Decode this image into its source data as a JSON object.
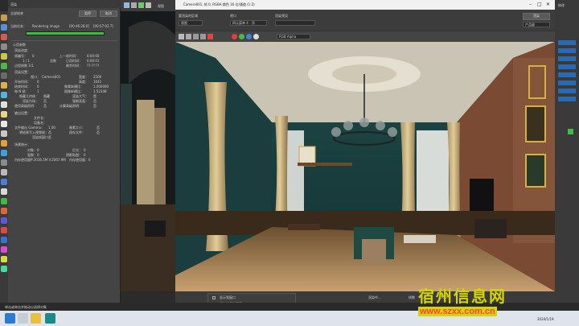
{
  "progress_window": {
    "title": "渲染",
    "pause_label": "暂停",
    "cancel_label": "取消",
    "header_label": "全部结束",
    "current_task_label": "当前任务：",
    "current_task_value": "Rendering image",
    "time1": "[00:46:28.0]",
    "time2": "[00:57:02.7]",
    "progress_percent": 100,
    "common_params_title": "公用参数",
    "render_progress_label": "渲染进度：",
    "frame_count_label": "帧编号：",
    "frame_count_value": "0",
    "last_frame_time_label": "上一帧时间：",
    "last_frame_time_value": "0:00:00",
    "frames_done_value": "1 / 1",
    "total_label": "总数",
    "elapsed_label": "已用时间：",
    "elapsed_value": "0:00:01",
    "pass_label": "过程帧数 1/1",
    "remaining_label": "剩余时间：",
    "remaining_value": "??:??:??",
    "render_settings_title": "渲染设置：",
    "viewport_label": "视口：",
    "viewport_value": "Camera001",
    "width_label": "宽度：",
    "width_value": "2500",
    "cameras_label": "开始时间：",
    "cameras_value": "0",
    "height_label": "高度：",
    "height_value": "1641",
    "end_label": "结束时间：",
    "end_value": "0",
    "aspect_label": "像素纵横比：",
    "aspect_value": "1.000000",
    "frames_label": "每 N 帧：",
    "frames_value": "1",
    "img_aspect_label": "图像纵横比：",
    "img_aspect_value": "1.52348",
    "fx1_label": "隐藏几何体：",
    "fx1_value": "隐藏",
    "fx2_label": "渲染大气：",
    "fx2_value": "是",
    "fx3_label": "渲染为场：",
    "fx3_value": "否",
    "fx4_label": "强制双面：",
    "fx4_value": "否",
    "fx5_label": "使用高级照明：",
    "fx5_value": "否",
    "fx6_label": "计算高级照明：",
    "fx6_value": "否",
    "output_title": "输出设置：",
    "out1": "文件名：",
    "out2": "设备名：",
    "out3_label": "文件输出 Gamma：",
    "out3_value": "1.00",
    "out4_label": "像素大小：",
    "out4_value": "否",
    "out5_label": "将结果写入视频帧：",
    "out5_value": "否",
    "out6_label": "保存文件：",
    "out6_value": "否",
    "out7_label": "渲染帧窗口：",
    "out7_value": "否",
    "stats_title": "场景统计：",
    "st1_label": "对象：",
    "st1_value": "0",
    "st2_label": "灯光：",
    "st2_value": "0",
    "st3_label": "面数：",
    "st3_value": "0",
    "st4_label": "阴影贴图：",
    "st4_value": "0",
    "st5_label": "内存使用量：",
    "st5_value": "P:2016.1M V:2067.9M",
    "st6_label": "内存使用量：",
    "st6_value": "0"
  },
  "mid_toolbar": {
    "title": "视图"
  },
  "render_frame": {
    "title": "Camera001, 帧 0, RGBA 颜色 16 位/通道 (1:2)",
    "render_area_label": "要渲染的区域",
    "render_area_value": "视图",
    "viewport_label": "视口",
    "viewport_value": "四元菜单 4 - 顶",
    "render_preset_label": "渲染预设",
    "render_preset_value": "",
    "render_button": "渲染",
    "production_value": "产品级",
    "channel_value": "RGB Alpha",
    "status_rendering_label": "渲染中…",
    "status_percent": "100%",
    "status_left": "帧数",
    "status_right": "1/1"
  },
  "popup": {
    "item1": "显示到窗口",
    "item2": "保存时保持背景"
  },
  "left_status": {
    "line1": "单击或单击并拖动以选择对象"
  },
  "taskbar": {
    "date": "2024/1/19",
    "time": ""
  },
  "watermark": {
    "text": "宿州信息网",
    "url": "www.szxx.com.cn"
  },
  "right_panel": {
    "title": "修改"
  }
}
